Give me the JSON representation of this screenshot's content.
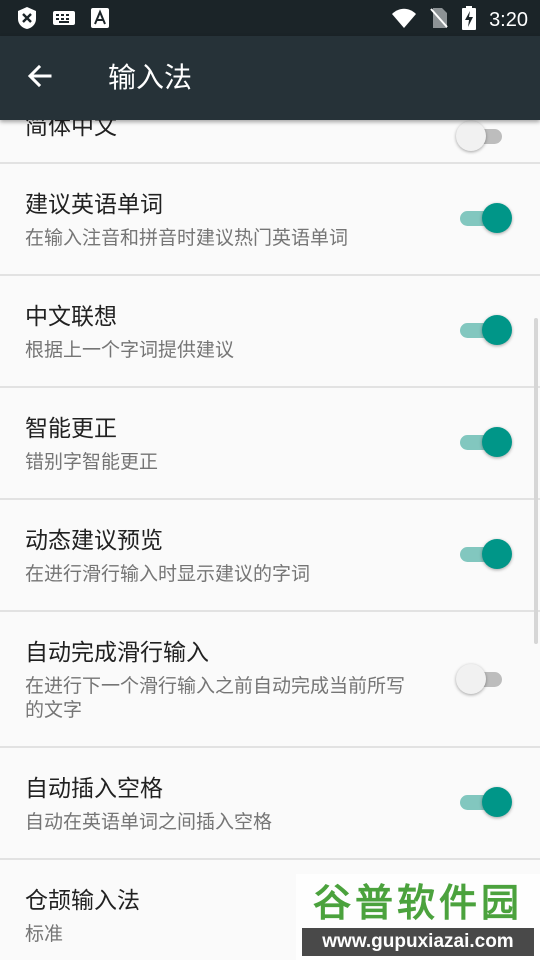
{
  "status_bar": {
    "time": "3:20",
    "icons": [
      "close-box-icon",
      "keyboard-icon",
      "text-a-icon",
      "wifi-icon",
      "no-sim-icon",
      "battery-charging-icon"
    ]
  },
  "app_bar": {
    "title": "输入法",
    "back_icon": "arrow-left-icon"
  },
  "settings": [
    {
      "title": "简体中文",
      "subtitle": "",
      "enabled": false
    },
    {
      "title": "建议英语单词",
      "subtitle": "在输入注音和拼音时建议热门英语单词",
      "enabled": true
    },
    {
      "title": "中文联想",
      "subtitle": "根据上一个字词提供建议",
      "enabled": true
    },
    {
      "title": "智能更正",
      "subtitle": "错别字智能更正",
      "enabled": true
    },
    {
      "title": "动态建议预览",
      "subtitle": "在进行滑行输入时显示建议的字词",
      "enabled": true
    },
    {
      "title": "自动完成滑行输入",
      "subtitle": "在进行下一个滑行输入之前自动完成当前所写的文字",
      "enabled": false
    },
    {
      "title": "自动插入空格",
      "subtitle": "自动在英语单词之间插入空格",
      "enabled": true
    },
    {
      "title": "仓颉输入法",
      "subtitle": "标准"
    }
  ],
  "watermark": {
    "brand": "谷普软件园",
    "url": "www.gupuxiazai.com"
  },
  "colors": {
    "status_bar": "#1b2428",
    "app_bar": "#263238",
    "accent": "#009688",
    "accent_track": "#82c7bf",
    "background": "#fafafa"
  }
}
